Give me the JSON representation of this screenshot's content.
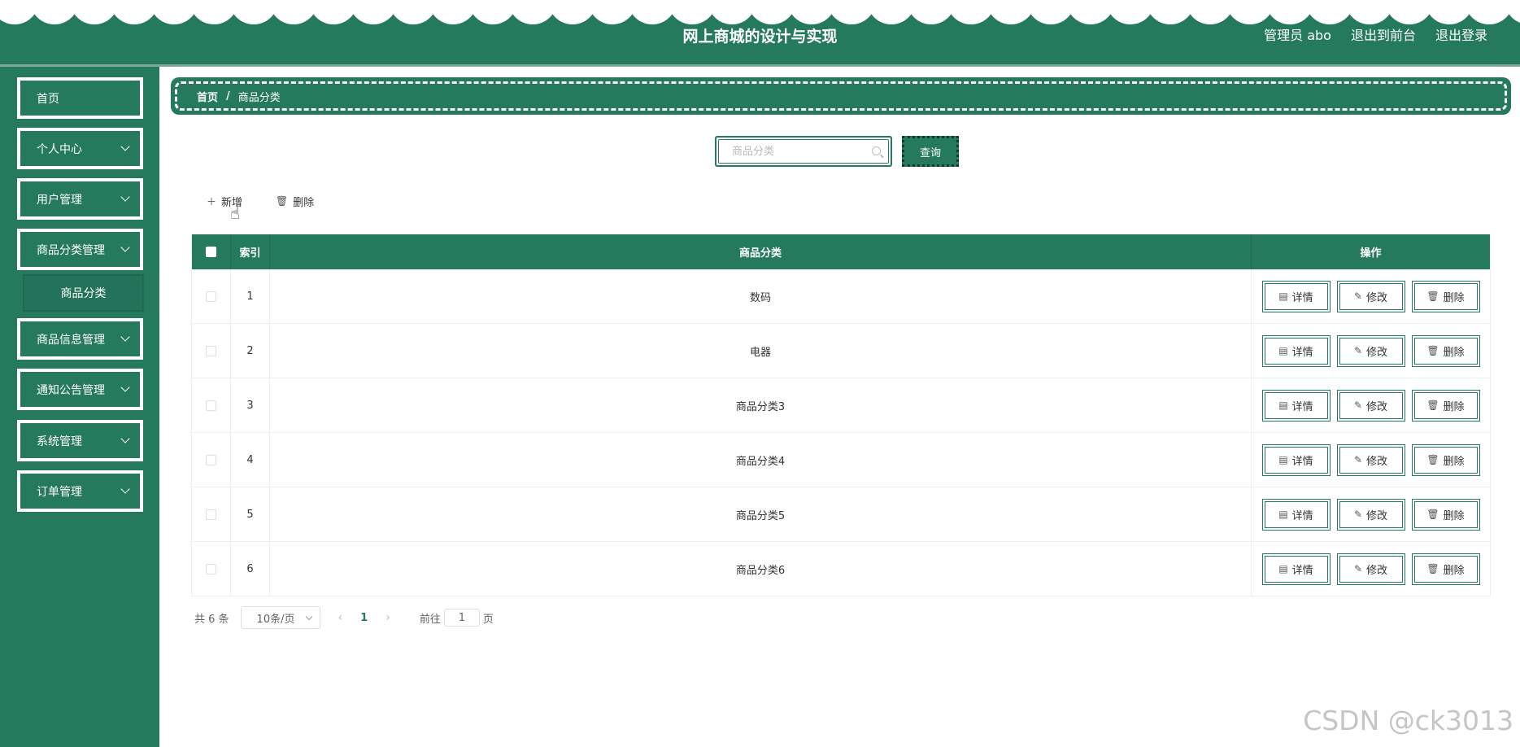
{
  "header": {
    "title": "网上商城的设计与实现",
    "user": "管理员 abo",
    "exit_front": "退出到前台",
    "logout": "退出登录"
  },
  "sidebar": {
    "items": [
      {
        "label": "首页",
        "has_arrow": false
      },
      {
        "label": "个人中心",
        "has_arrow": true
      },
      {
        "label": "用户管理",
        "has_arrow": true
      },
      {
        "label": "商品分类管理",
        "has_arrow": true
      },
      {
        "label": "商品信息管理",
        "has_arrow": true
      },
      {
        "label": "通知公告管理",
        "has_arrow": true
      },
      {
        "label": "系统管理",
        "has_arrow": true
      },
      {
        "label": "订单管理",
        "has_arrow": true
      }
    ],
    "submenu_active": "商品分类"
  },
  "breadcrumb": {
    "home": "首页",
    "sep": "/",
    "current": "商品分类"
  },
  "search": {
    "placeholder": "商品分类",
    "value": "",
    "button": "查询"
  },
  "toolbar": {
    "add": "新增",
    "delete": "删除"
  },
  "table": {
    "headers": {
      "index": "索引",
      "name": "商品分类",
      "ops": "操作"
    },
    "rows": [
      {
        "index": "1",
        "name": "数码"
      },
      {
        "index": "2",
        "name": "电器"
      },
      {
        "index": "3",
        "name": "商品分类3"
      },
      {
        "index": "4",
        "name": "商品分类4"
      },
      {
        "index": "5",
        "name": "商品分类5"
      },
      {
        "index": "6",
        "name": "商品分类6"
      }
    ],
    "actions": {
      "detail": "详情",
      "edit": "修改",
      "delete": "删除"
    }
  },
  "pagination": {
    "total": "共 6 条",
    "page_size": "10条/页",
    "current": "1",
    "goto_label": "前往",
    "goto_value": "1",
    "page_unit": "页"
  },
  "watermark": "CSDN @ck3013",
  "colors": {
    "primary": "#257a5e"
  }
}
